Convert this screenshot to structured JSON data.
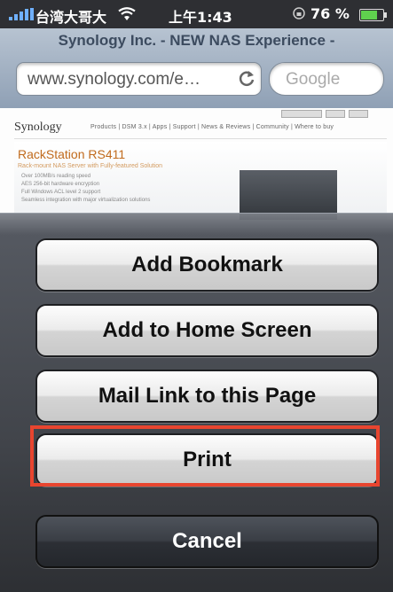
{
  "status_bar": {
    "carrier": "台湾大哥大",
    "time": "上午1:43",
    "battery": "76 %",
    "battery_level": 0.76
  },
  "browser": {
    "page_title": "Synology Inc. - NEW NAS Experience -",
    "url": "www.synology.com/e…",
    "search_placeholder": "Google"
  },
  "web": {
    "logo": "Synology",
    "nav": "Products  |  DSM 3.x  |  Apps  |  Support  |  News & Reviews  |  Community  |  Where to buy",
    "hero_title": "RackStation RS411",
    "hero_subtitle": "Rack-mount NAS Server with Fully-featured Solution",
    "bullets": [
      "Over 100MB/s reading speed",
      "AES 256-bit hardware encryption",
      "Full Windows ACL level 2 support",
      "Seamless integration with major virtualization solutions"
    ]
  },
  "action_sheet": {
    "buttons": [
      "Add Bookmark",
      "Add to Home Screen",
      "Mail Link to this Page",
      "Print"
    ],
    "cancel": "Cancel"
  },
  "colors": {
    "highlight": "#e8452f",
    "battery_fill": "#5fd14e"
  }
}
